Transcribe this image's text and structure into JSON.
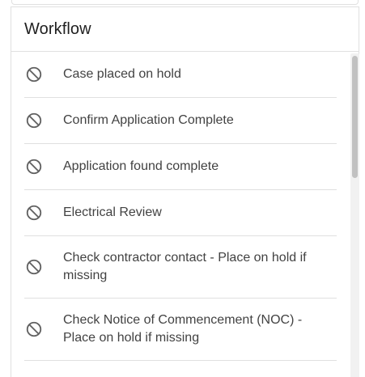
{
  "workflow": {
    "title": "Workflow",
    "items": [
      {
        "label": "Case placed on hold",
        "icon": "block-icon"
      },
      {
        "label": "Confirm Application Complete",
        "icon": "block-icon"
      },
      {
        "label": "Application found complete",
        "icon": "block-icon"
      },
      {
        "label": "Electrical Review",
        "icon": "block-icon"
      },
      {
        "label": "Check contractor contact - Place on hold if missing",
        "icon": "block-icon"
      },
      {
        "label": "Check Notice of Commencement (NOC) - Place on hold if missing",
        "icon": "block-icon"
      }
    ]
  },
  "colors": {
    "text": "#424242",
    "title": "#212121",
    "icon": "#616161",
    "divider": "#e0e0e0"
  }
}
